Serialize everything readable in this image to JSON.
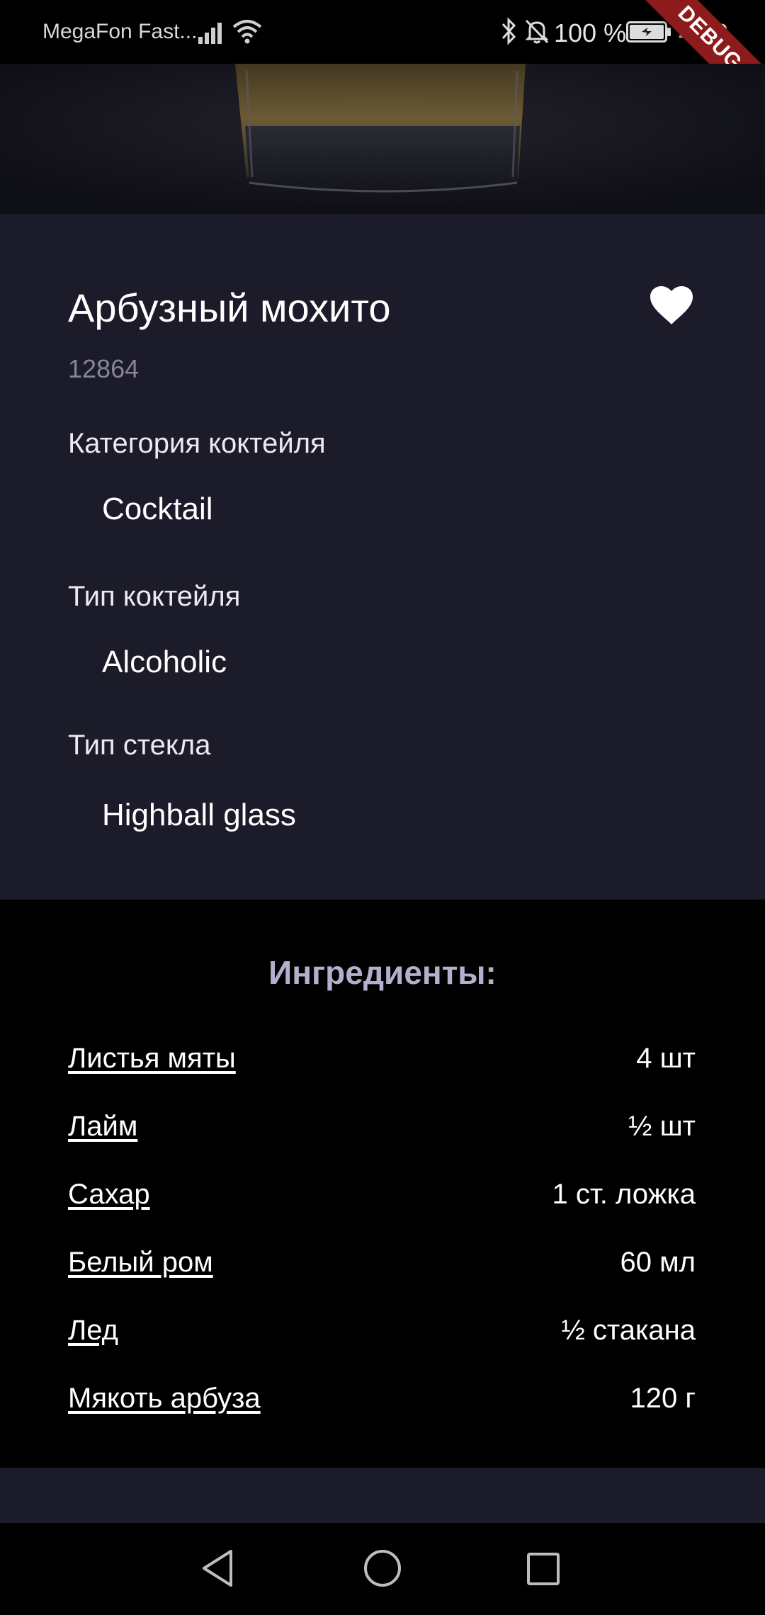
{
  "status_bar": {
    "carrier": "MegaFon Fast...",
    "battery_percent": "100 %",
    "time": "4:53",
    "debug_banner": "DEBUG",
    "icons": [
      "signal-icon",
      "wifi-icon",
      "bluetooth-icon",
      "mute-icon",
      "battery-icon"
    ]
  },
  "hero": {
    "image": "cocktail-glass-photo"
  },
  "drink": {
    "name": "Арбузный мохито",
    "id": "12864",
    "favorite": true,
    "favorite_icon": "heart-icon"
  },
  "details": {
    "category_label": "Категория коктейля",
    "category_value": "Cocktail",
    "type_label": "Тип коктейля",
    "type_value": "Alcoholic",
    "glass_label": "Тип стекла",
    "glass_value": "Highball glass"
  },
  "ingredients": {
    "title": "Ингредиенты:",
    "items": [
      {
        "name": "Листья мяты",
        "measure": "4 шт"
      },
      {
        "name": "Лайм",
        "measure": "½ шт"
      },
      {
        "name": "Сахар",
        "measure": "1 ст. ложка"
      },
      {
        "name": "Белый ром",
        "measure": "60 мл"
      },
      {
        "name": "Лед",
        "measure": "½ стакана"
      },
      {
        "name": "Мякоть арбуза",
        "measure": "120 г"
      }
    ]
  },
  "nav_bar": {
    "icons": [
      "back-icon",
      "home-icon",
      "recents-icon"
    ]
  },
  "colors": {
    "background": "#000000",
    "card": "#1c1b29",
    "accent_title": "#b2b0cc",
    "secondary_text": "#85849a",
    "debug": "#8e1b1b"
  }
}
